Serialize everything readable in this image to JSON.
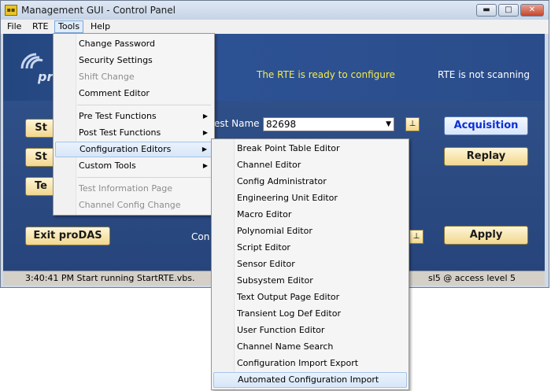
{
  "window": {
    "title": "Management GUI - Control Panel",
    "icon": "app-icon",
    "controls": {
      "minimize": "▬",
      "maximize": "□",
      "close": "✕"
    }
  },
  "menubar": {
    "items": [
      "File",
      "RTE",
      "Tools",
      "Help"
    ],
    "active": "Tools"
  },
  "status": {
    "ready": "The RTE is ready to configure",
    "scan": "RTE is not scanning"
  },
  "buttons": {
    "start1": "St",
    "start2": "St",
    "te": "Te",
    "exit": "Exit proDAS",
    "acquisition": "Acquisition",
    "replay": "Replay",
    "apply": "Apply"
  },
  "labels": {
    "test_name": "est Name",
    "con": "Con"
  },
  "test_name_value": "82698",
  "statusbar": {
    "left": "3:40:41 PM Start running StartRTE.vbs.",
    "right": "sl5 @ access level 5"
  },
  "tools_menu": [
    {
      "label": "Change Password",
      "enabled": true
    },
    {
      "label": "Security Settings",
      "enabled": true
    },
    {
      "label": "Shift Change",
      "enabled": false
    },
    {
      "label": "Comment Editor",
      "enabled": true
    },
    {
      "label": "Pre Test Functions",
      "enabled": true,
      "submenu": true
    },
    {
      "label": "Post Test Functions",
      "enabled": true,
      "submenu": true
    },
    {
      "label": "Configuration Editors",
      "enabled": true,
      "submenu": true,
      "highlighted": true
    },
    {
      "label": "Custom Tools",
      "enabled": true,
      "submenu": true
    },
    {
      "label": "Test Information Page",
      "enabled": false
    },
    {
      "label": "Channel Config Change",
      "enabled": false
    }
  ],
  "config_editors_menu": [
    "Break Point Table Editor",
    "Channel Editor",
    "Config Administrator",
    "Engineering Unit Editor",
    "Macro Editor",
    "Polynomial Editor",
    "Script Editor",
    "Sensor Editor",
    "Subsystem Editor",
    "Text Output Page Editor",
    "Transient Log Def Editor",
    "User Function Editor",
    "Channel Name Search",
    "Configuration Import Export",
    "Automated Configuration Import"
  ],
  "config_editors_highlighted": "Automated Configuration Import",
  "colors": {
    "status_ready": "#f3ec4a",
    "acquisition_text": "#0b2fd6",
    "client_blue": "#2c4f8e"
  }
}
